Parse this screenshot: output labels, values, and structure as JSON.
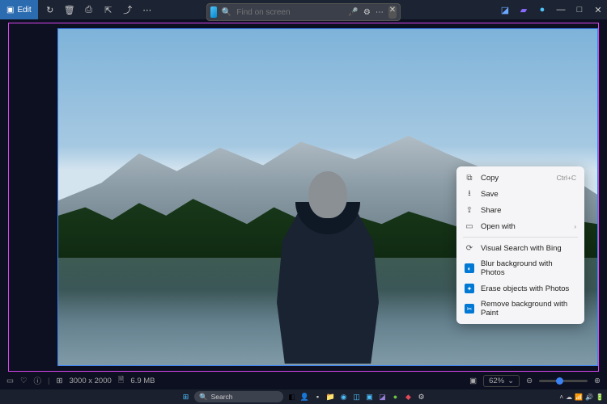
{
  "titlebar": {
    "edit": "Edit"
  },
  "search": {
    "placeholder": "Find on screen"
  },
  "context_menu": {
    "items": [
      {
        "icon": "⧉",
        "label": "Copy",
        "shortcut": "Ctrl+C"
      },
      {
        "icon": "⭳",
        "label": "Save"
      },
      {
        "icon": "⇪",
        "label": "Share"
      },
      {
        "icon": "▭",
        "label": "Open with",
        "submenu": true,
        "sep_after": true
      },
      {
        "icon": "⟳",
        "label": "Visual Search with Bing"
      },
      {
        "icon_blue": true,
        "icon": "◐",
        "label": "Blur background with Photos"
      },
      {
        "icon_blue": true,
        "icon": "✦",
        "label": "Erase objects with Photos"
      },
      {
        "icon_blue": true,
        "icon": "✂",
        "label": "Remove background with Paint"
      }
    ]
  },
  "status": {
    "dimensions": "3000 x 2000",
    "filesize": "6.9 MB",
    "zoom": "62%"
  },
  "taskbar": {
    "search": "Search"
  }
}
